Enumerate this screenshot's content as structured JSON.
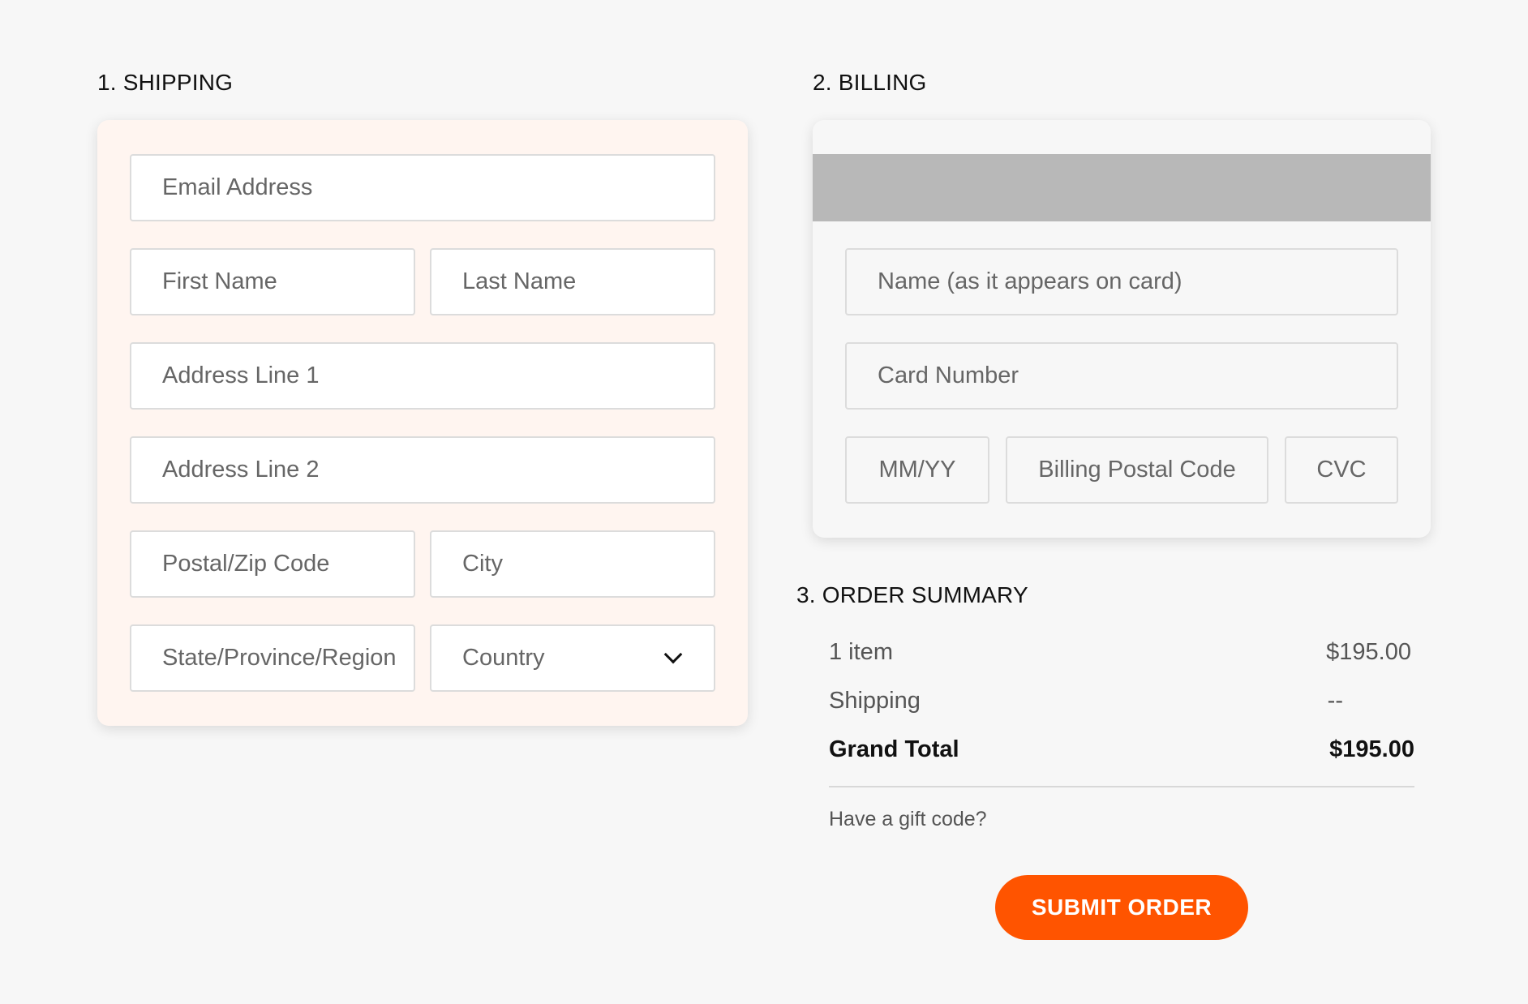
{
  "shipping": {
    "title": "1. SHIPPING",
    "email_placeholder": "Email Address",
    "first_name_placeholder": "First Name",
    "last_name_placeholder": "Last Name",
    "address1_placeholder": "Address Line 1",
    "address2_placeholder": "Address Line 2",
    "postal_placeholder": "Postal/Zip Code",
    "city_placeholder": "City",
    "state_placeholder": "State/Province/Region",
    "country_placeholder": "Country",
    "card_background": "#fff5f0"
  },
  "billing": {
    "title": "2. BILLING",
    "name_placeholder": "Name (as it appears on card)",
    "card_number_placeholder": "Card Number",
    "expiry_placeholder": "MM/YY",
    "postal_placeholder": "Billing Postal Code",
    "cvc_placeholder": "CVC"
  },
  "summary": {
    "title": "3. ORDER SUMMARY",
    "items_label": "1 item",
    "items_value": "$195.00",
    "shipping_label": "Shipping",
    "shipping_value": "--",
    "total_label": "Grand Total",
    "total_value": "$195.00",
    "gift_code_link": "Have a gift code?"
  },
  "submit_label": "SUBMIT ORDER",
  "colors": {
    "accent": "#ff5400",
    "page_background": "#f7f7f7",
    "billing_band": "#b8b8b8"
  }
}
